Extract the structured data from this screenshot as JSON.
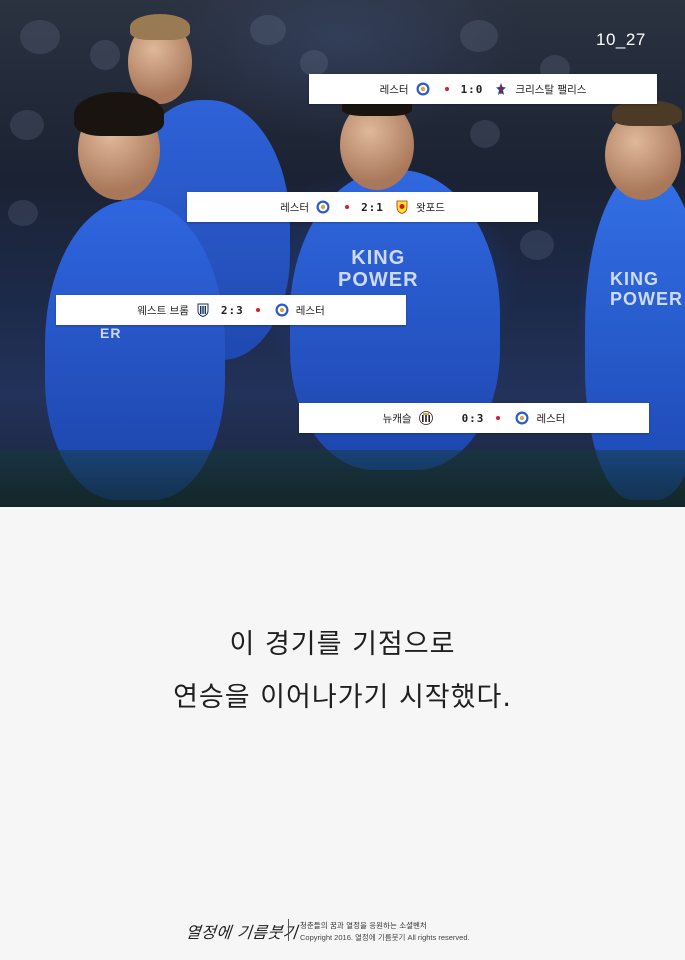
{
  "page_number": "10_27",
  "results": [
    {
      "home": "레스터",
      "home_crest": "leicester-crest-icon",
      "score": "1:0",
      "away": "크리스탈 팰리스",
      "away_crest": "crystal-palace-crest-icon",
      "dot_side": "home"
    },
    {
      "home": "레스터",
      "home_crest": "leicester-crest-icon",
      "score": "2:1",
      "away": "왓포드",
      "away_crest": "watford-crest-icon",
      "dot_side": "home"
    },
    {
      "home": "웨스트 브롬",
      "home_crest": "west-brom-crest-icon",
      "score": "2:3",
      "away": "레스터",
      "away_crest": "leicester-crest-icon",
      "dot_side": "away"
    },
    {
      "home": "뉴캐슬",
      "home_crest": "newcastle-crest-icon",
      "score": "0:3",
      "away": "레스터",
      "away_crest": "leicester-crest-icon",
      "dot_side": "away"
    }
  ],
  "photo": {
    "shirt_sponsor_line1": "KING",
    "shirt_sponsor_line2": "POWER"
  },
  "caption": {
    "line1": "이 경기를 기점으로",
    "line2": "연승을 이어나가기 시작했다."
  },
  "footer": {
    "logo": "열정에 기름붓기",
    "tagline": "청춘들의 꿈과 열정을 응원하는 소셜벤처",
    "copyright": "Copyright 2016. 열정에 기름붓기 All rights reserved."
  },
  "colors": {
    "leicester_blue": "#2a5bd1",
    "dot_red": "#d61f2b",
    "background": "#f6f6f6"
  }
}
